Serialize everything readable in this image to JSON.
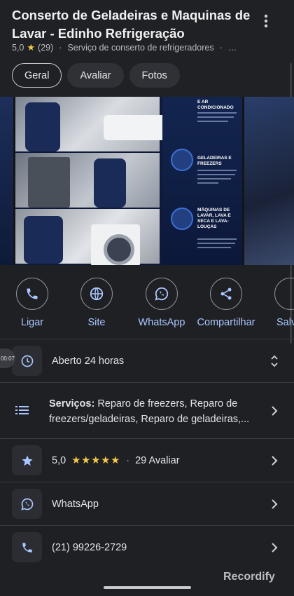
{
  "header": {
    "title": "Conserto de Geladeiras e Maquinas de Lavar - Edinho Refrigeração",
    "rating": "5,0",
    "review_count": "(29)",
    "category": "Serviço de conserto de refrigeradores",
    "category_more": "…"
  },
  "tabs": [
    {
      "label": "Geral",
      "active": true
    },
    {
      "label": "Avaliar",
      "active": false
    },
    {
      "label": "Fotos",
      "active": false
    }
  ],
  "gallery": {
    "heading_1": "E AR CONDICIONADO",
    "heading_2": "GELADEIRAS E FREEZERS",
    "heading_3": "MÁQUINAS DE LAVAR, LAVA E SECA E LAVA-LOUÇAS"
  },
  "actions": [
    {
      "label": "Ligar",
      "icon": "phone-icon"
    },
    {
      "label": "Site",
      "icon": "globe-icon"
    },
    {
      "label": "WhatsApp",
      "icon": "whatsapp-icon"
    },
    {
      "label": "Compartilhar",
      "icon": "share-icon"
    },
    {
      "label": "Salv",
      "icon": "bookmark-icon"
    }
  ],
  "details": {
    "hours": "Aberto 24 horas",
    "services_label": "Serviços:",
    "services_line1": " Reparo de freezers, Reparo de",
    "services_line2": "freezers/geladeiras, Reparo de geladeiras,...",
    "rating": "5,0",
    "stars": "★★★★★",
    "sep": "·",
    "reviews": "29 Avaliar",
    "whatsapp": "WhatsApp",
    "phone": "(21) 99226-2729"
  },
  "overlay": {
    "timer": "00:07",
    "watermark": "Recordify"
  },
  "colors": {
    "accent": "#aac7ff",
    "open": "#6dd58c",
    "star": "#f7c948",
    "background": "#1f2024"
  }
}
